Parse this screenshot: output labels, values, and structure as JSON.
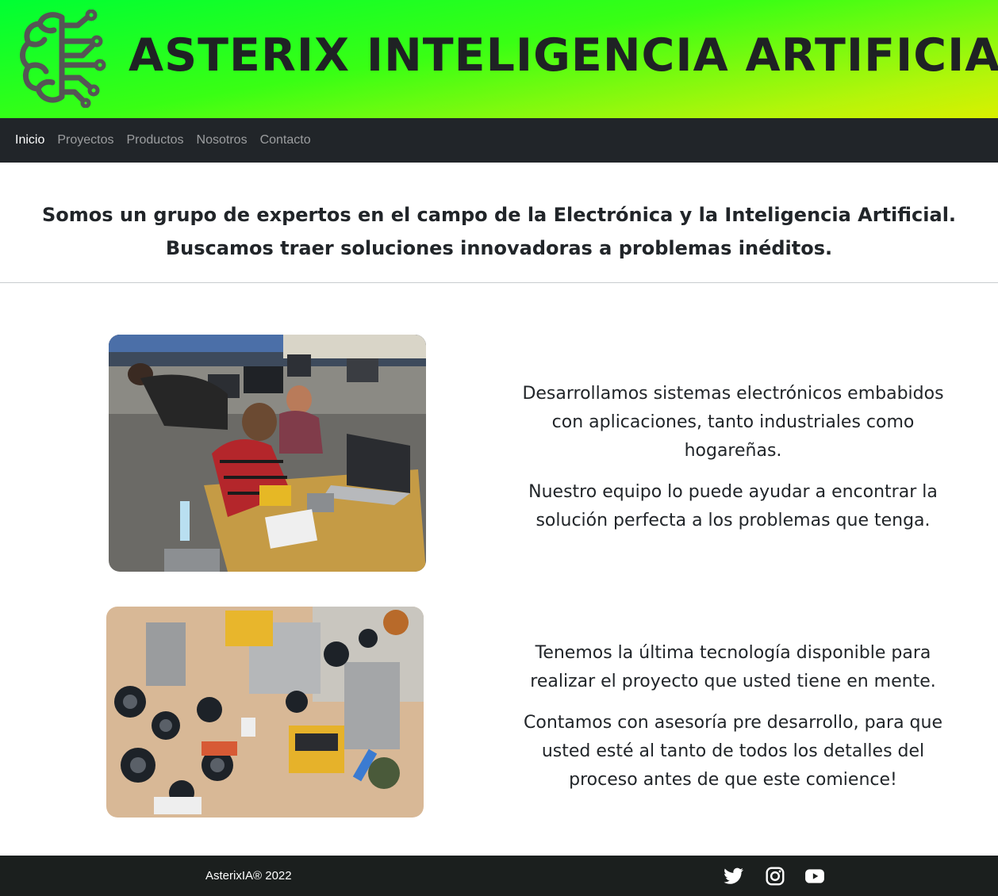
{
  "header": {
    "title": "ASTERIX INTELIGENCIA ARTIFICIAL",
    "logo_icon": "brain-circuit-icon"
  },
  "nav": {
    "items": [
      {
        "label": "Inicio",
        "active": true
      },
      {
        "label": "Proyectos",
        "active": false
      },
      {
        "label": "Productos",
        "active": false
      },
      {
        "label": "Nosotros",
        "active": false
      },
      {
        "label": "Contacto",
        "active": false
      }
    ]
  },
  "intro": {
    "line1": "Somos un grupo de expertos en el campo de la Electrónica y la Inteligencia Artificial.",
    "line2": "Buscamos traer soluciones innovadoras a problemas inéditos."
  },
  "features": [
    {
      "image": "team-workshop-photo",
      "paragraphs": [
        "Desarrollamos sistemas electrónicos embabidos con aplicaciones, tanto industriales como hogareñas.",
        "Nuestro equipo lo puede ayudar a encontrar la solución perfecta a los problemas que tenga."
      ]
    },
    {
      "image": "circuit-board-photo",
      "paragraphs": [
        "Tenemos la última tecnología disponible para realizar el proyecto que usted tiene en mente.",
        "Contamos con asesoría pre desarrollo, para que usted esté al tanto de todos los detalles del proceso antes de que este comience!"
      ]
    }
  ],
  "footer": {
    "copyright": "AsterixIA® 2022",
    "social": [
      "twitter-icon",
      "instagram-icon",
      "youtube-icon"
    ]
  },
  "colors": {
    "banner_start": "#00ff33",
    "banner_end": "#d9f000",
    "navbar_bg": "#212529",
    "footer_bg": "#1b1f1e",
    "text": "#212529"
  }
}
